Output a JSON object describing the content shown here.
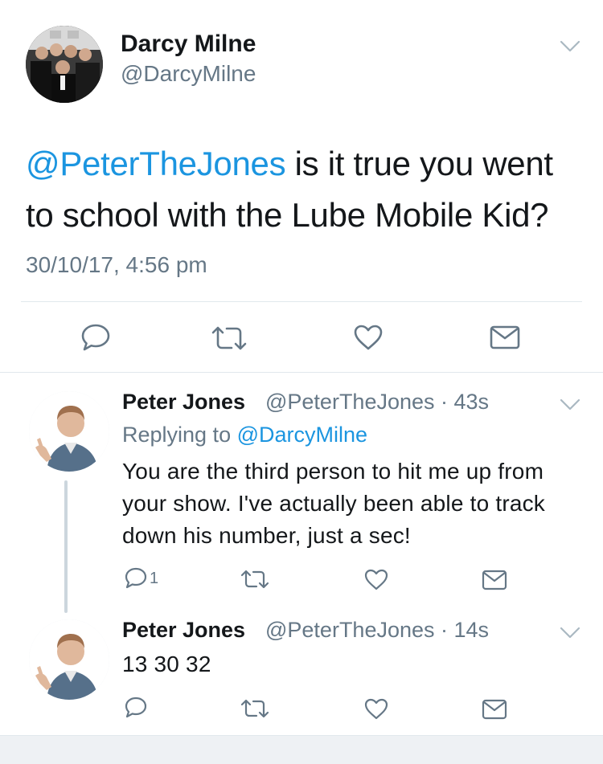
{
  "main_tweet": {
    "display_name": "Darcy Milne",
    "handle": "@DarcyMilne",
    "mention": "@PeterTheJones",
    "text": " is it true you went to school with the Lube Mobile Kid?",
    "timestamp": "30/10/17, 4:56 pm"
  },
  "replies": [
    {
      "display_name": "Peter Jones",
      "handle_time": "@PeterTheJones · 43s",
      "replying_prefix": "Replying to ",
      "replying_to": "@DarcyMilne",
      "text": "You are the third person to hit me up from your show. I've actually been able to track down his number, just a sec!",
      "reply_count": "1"
    },
    {
      "display_name": "Peter Jones",
      "handle_time": "@PeterTheJones · 14s",
      "text": "13 30 32"
    }
  ],
  "colors": {
    "link": "#1b95e0",
    "secondary": "#657786",
    "icon": "#657786",
    "border": "#e1e8ed"
  },
  "icons": [
    "chevron-down-icon",
    "reply-icon",
    "retweet-icon",
    "like-icon",
    "message-icon"
  ]
}
